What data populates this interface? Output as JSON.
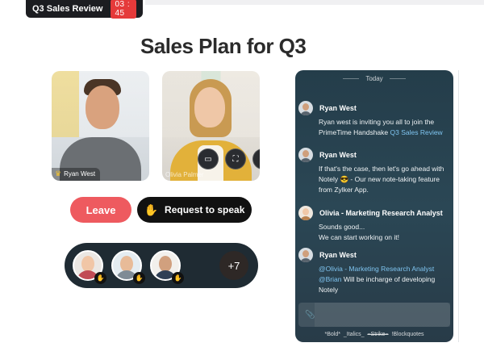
{
  "meeting": {
    "title": "Q3 Sales Review",
    "timer": "03 : 45"
  },
  "page": {
    "title": "Sales Plan for Q3"
  },
  "tiles": [
    {
      "name": "Ryan West",
      "host": true
    },
    {
      "name": "Olivia Palmer"
    }
  ],
  "tile_controls": [
    {
      "icon": "picture-in-picture-icon",
      "glyph": "▭"
    },
    {
      "icon": "fullscreen-icon",
      "glyph": "⛶"
    },
    {
      "icon": "chat-icon",
      "glyph": "▣"
    }
  ],
  "actions": {
    "leave": "Leave",
    "request_to_speak": "Request to speak"
  },
  "participants": {
    "more": "+7"
  },
  "chat": {
    "date_label": "Today",
    "messages": [
      {
        "sender": "Ryan West",
        "text_before": "Ryan  west is inviting you all to join the PrimeTime Handshake ",
        "link": "Q3 Sales Review",
        "text_after": ""
      },
      {
        "sender": "Ryan West",
        "text_before": "If that's the case, then let's go ahead with Notely ",
        "emoji": "😎",
        "text_after": "  - Our new note-taking feature from Zylker App."
      },
      {
        "sender": "Olivia - Marketing Research Analyst",
        "line1": "Sounds good...",
        "line2": "We can start working on it!"
      },
      {
        "sender": "Ryan West",
        "mention1": "@Olivia - Marketing Research Analyst",
        "mention2": "@Brian",
        "text_after": " Will be incharge of developing Notely"
      }
    ],
    "format_hint": {
      "bold": "*Bold*",
      "italics": "_Italics_",
      "strike": "~Strike~",
      "blockquote": "!Blockquotes"
    }
  },
  "colors": {
    "leave": "#ee5a5f",
    "timer": "#e53a3a",
    "link": "#7fc4f0",
    "chat_bg": "#2b4755"
  }
}
